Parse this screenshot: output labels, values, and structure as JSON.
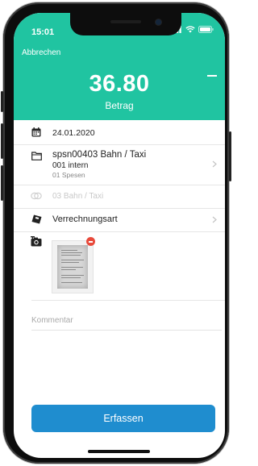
{
  "status_bar": {
    "time": "15:01",
    "icons": [
      "signal-icon",
      "wifi-icon",
      "battery-icon"
    ]
  },
  "header": {
    "cancel_label": "Abbrechen",
    "amount": "36.80",
    "amount_label": "Betrag",
    "menu_icon": "dash-icon"
  },
  "fields": {
    "date": {
      "icon": "calendar-icon",
      "value": "24.01.2020"
    },
    "category": {
      "icon": "folder-icon",
      "title": "spsn00403 Bahn / Taxi",
      "subtitle1": "001 intern",
      "subtitle2": "01 Spesen",
      "chevron": "chevron-right-icon"
    },
    "disabled_category": {
      "icon": "coins-icon",
      "value": "03 Bahn / Taxi"
    },
    "billing": {
      "icon": "tag-icon",
      "label": "Verrechnungsart",
      "chevron": "chevron-right-icon"
    },
    "attachment": {
      "icon": "add-photo-icon"
    }
  },
  "comment": {
    "placeholder": "Kommentar"
  },
  "submit": {
    "label": "Erfassen"
  },
  "colors": {
    "header": "#20c4a1",
    "button": "#1f8dcf",
    "badge": "#e84a3b"
  }
}
